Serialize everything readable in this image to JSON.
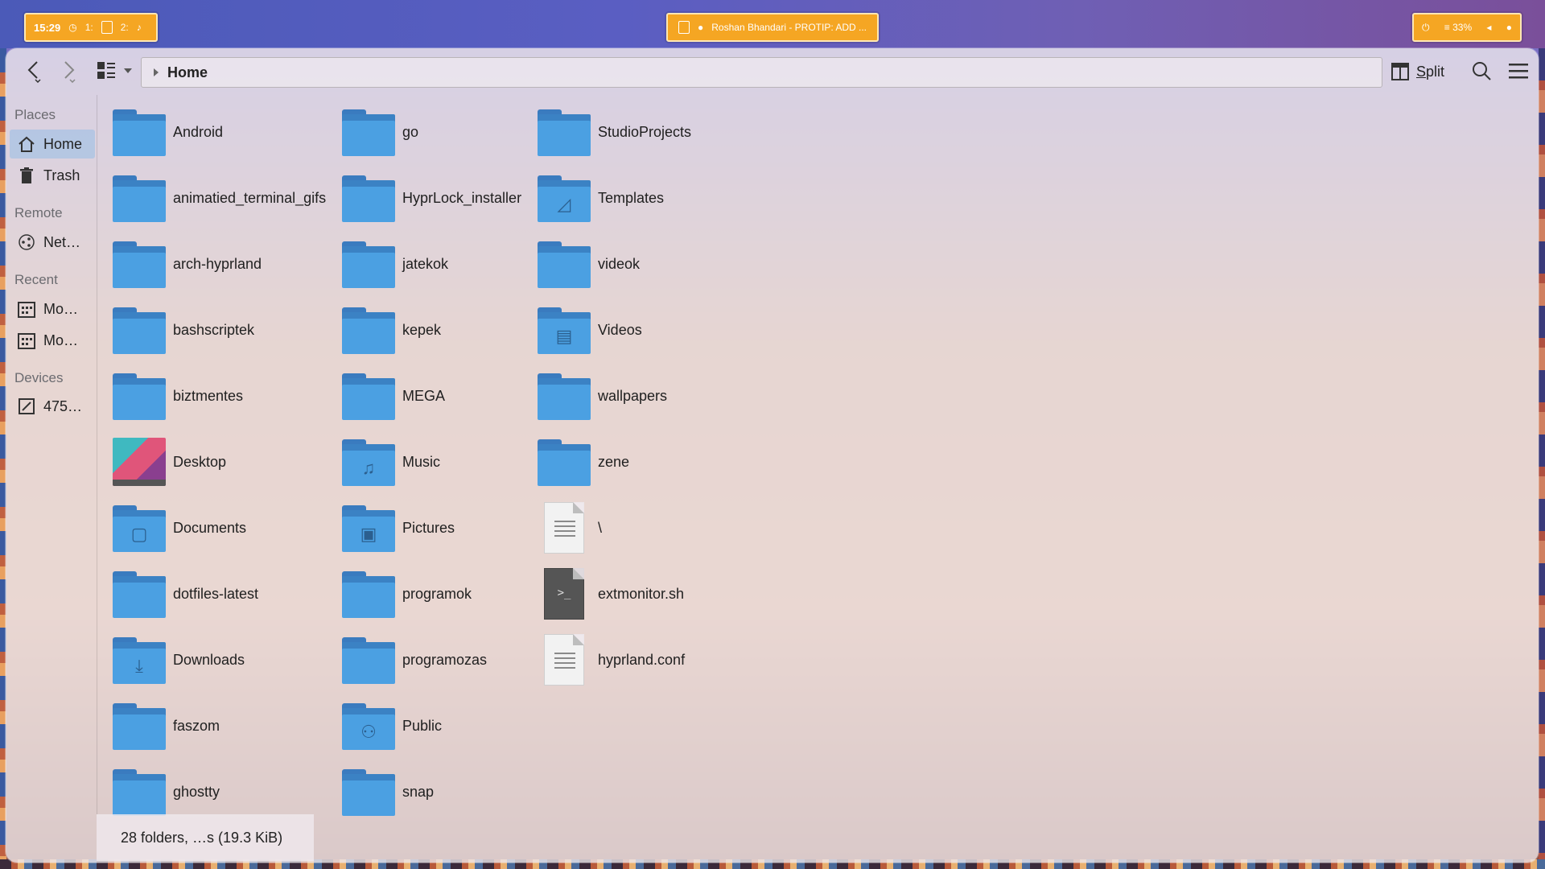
{
  "topbar": {
    "clock": "15:29",
    "workspace1": "1:",
    "workspace2": "2:",
    "center_title": "Roshan Bhandari - PROTIP: ADD ...",
    "battery": "33%"
  },
  "toolbar": {
    "breadcrumb": "Home",
    "split_label": "Split",
    "split_mnemonic": "S",
    "split_rest": "plit"
  },
  "sidebar": {
    "sections": [
      {
        "title": "Places",
        "items": [
          {
            "label": "Home",
            "icon": "home-icon"
          },
          {
            "label": "Trash",
            "icon": "trash-icon"
          }
        ]
      },
      {
        "title": "Remote",
        "items": [
          {
            "label": "Net…",
            "icon": "network-icon"
          }
        ]
      },
      {
        "title": "Recent",
        "items": [
          {
            "label": "Mo…",
            "icon": "calendar-icon"
          },
          {
            "label": "Mo…",
            "icon": "calendar-icon"
          }
        ]
      },
      {
        "title": "Devices",
        "items": [
          {
            "label": "475…",
            "icon": "drive-icon"
          }
        ]
      }
    ]
  },
  "files": {
    "col1": [
      "Android",
      "animatied_terminal_gifs",
      "arch-hyprland",
      "bashscriptek",
      "biztmentes",
      "Desktop",
      "Documents",
      "dotfiles-latest",
      "Downloads",
      "faszom",
      "ghostty"
    ],
    "col2": [
      "go",
      "HyprLock_installer",
      "jatekok",
      "kepek",
      "MEGA",
      "Music",
      "Pictures",
      "programok",
      "programozas",
      "Public",
      "snap"
    ],
    "col3": [
      "StudioProjects",
      "Templates",
      "videok",
      "Videos",
      "wallpapers",
      "zene",
      "\\",
      "extmonitor.sh",
      "hyprland.conf"
    ]
  },
  "status": {
    "summary": "28 folders, …s (19.3 KiB)"
  },
  "colors": {
    "accent": "#f5a623",
    "folder": "#4ba0e2",
    "selection": "#96bee6"
  }
}
